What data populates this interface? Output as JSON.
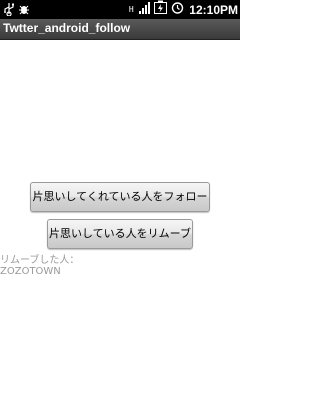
{
  "status_bar": {
    "icons": {
      "usb": "usb-icon",
      "bug": "debug-icon",
      "network_badge": "H",
      "signal": "signal-icon",
      "battery": "battery-charging-icon",
      "alarm": "alarm-icon"
    },
    "time": "12:10PM"
  },
  "app": {
    "title": "Twtter_android_follow"
  },
  "buttons": {
    "follow_back_label": "片思いしてくれている人をフォロー",
    "remove_label": "片思いしている人をリムーブ"
  },
  "removed": {
    "label": "リムーブした人：",
    "user": "ZOZOTOWN"
  },
  "colors": {
    "status_bar": "#000000",
    "title_bar": "#4a4a4a",
    "muted_text": "#9a9a9a"
  }
}
